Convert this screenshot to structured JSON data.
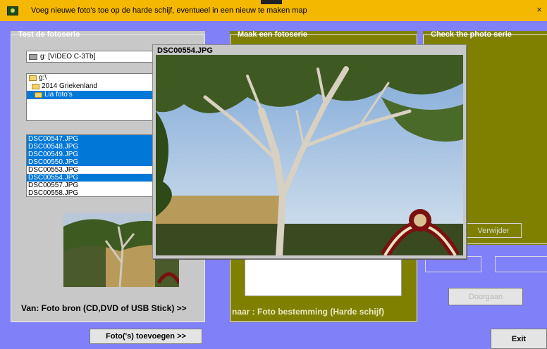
{
  "window": {
    "title": "Voeg nieuwe foto's toe op de harde schijf, eventueel in een nieuw te maken map",
    "close_glyph": "×"
  },
  "left_group": {
    "legend": "Test de fotoserie",
    "drive": "g: [VIDEO C-3Tb]",
    "directories": [
      "g:\\",
      "2014 Griekenland",
      "Lia foto's"
    ],
    "files": [
      "DSC00547.JPG",
      "DSC00548.JPG",
      "DSC00549.JPG",
      "DSC00550.JPG",
      "DSC00553.JPG",
      "DSC00554.JPG",
      "DSC00557.JPG",
      "DSC00558.JPG"
    ],
    "source_label": "Van: Foto bron (CD,DVD of USB Stick)  >>"
  },
  "middle_group": {
    "legend": "Maak een fotoserie",
    "dest_label": "naar :  Foto bestemming (Harde schijf)"
  },
  "right_group": {
    "legend": "Check the photo serie",
    "delete_button": "Verwijder",
    "continue_button": "Doorgaan"
  },
  "buttons": {
    "add_photos": "Foto('s) toevoegen >>",
    "exit": "Exit"
  },
  "preview": {
    "title": "DSC00554.JPG"
  },
  "colors": {
    "background": "#8080f8",
    "titlebar": "#f5b800",
    "olive": "#808000",
    "selection": "#0078d7"
  }
}
